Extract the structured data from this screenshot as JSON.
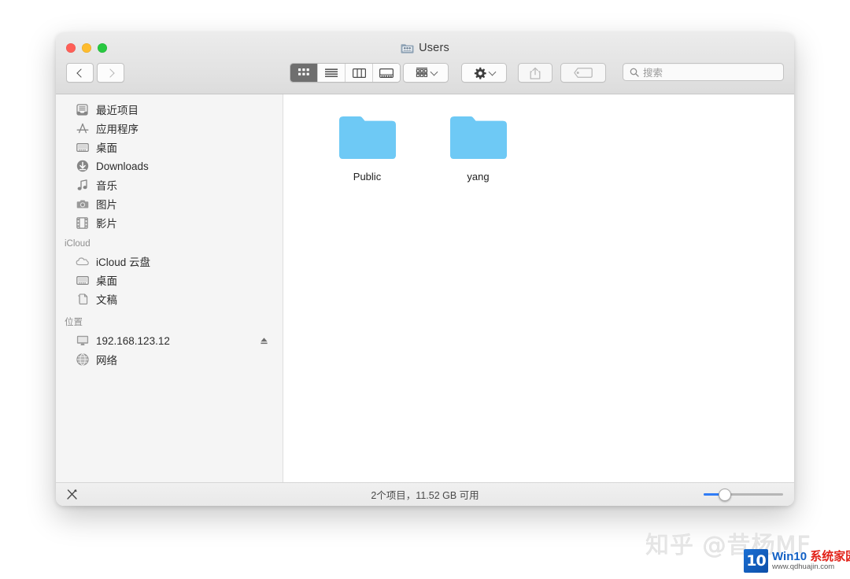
{
  "window": {
    "title": "Users",
    "title_icon": "users-folder-icon",
    "traffic_lights": [
      {
        "name": "close",
        "color": "#ff5f57"
      },
      {
        "name": "minimize",
        "color": "#febc2e"
      },
      {
        "name": "zoom",
        "color": "#28c840"
      }
    ]
  },
  "toolbar": {
    "back_label": "back-chevron",
    "forward_label": "forward-chevron",
    "view_modes": [
      {
        "name": "icon-view",
        "active": true
      },
      {
        "name": "list-view",
        "active": false
      },
      {
        "name": "column-view",
        "active": false
      },
      {
        "name": "gallery-view",
        "active": false
      }
    ],
    "arrange_button": "arrange-icon",
    "action_button": "gear-icon",
    "share_button": "share-icon",
    "tag_button": "tag-icon"
  },
  "search": {
    "placeholder": "搜索",
    "value": ""
  },
  "sidebar": {
    "sections": [
      {
        "title": "",
        "items": [
          {
            "label": "最近项目",
            "icon": "recents-icon"
          },
          {
            "label": "应用程序",
            "icon": "applications-icon"
          },
          {
            "label": "桌面",
            "icon": "desktop-icon"
          },
          {
            "label": "Downloads",
            "icon": "downloads-icon"
          },
          {
            "label": "音乐",
            "icon": "music-icon"
          },
          {
            "label": "图片",
            "icon": "pictures-icon"
          },
          {
            "label": "影片",
            "icon": "movies-icon"
          }
        ]
      },
      {
        "title": "iCloud",
        "items": [
          {
            "label": "iCloud 云盘",
            "icon": "icloud-icon"
          },
          {
            "label": "桌面",
            "icon": "desktop-icon"
          },
          {
            "label": "文稿",
            "icon": "documents-icon"
          }
        ]
      },
      {
        "title": "位置",
        "items": [
          {
            "label": "192.168.123.12",
            "icon": "server-icon",
            "eject": true
          },
          {
            "label": "网络",
            "icon": "network-icon"
          }
        ]
      }
    ]
  },
  "content": {
    "files": [
      {
        "name": "Public",
        "icon": "folder-icon"
      },
      {
        "name": "yang",
        "icon": "folder-icon"
      }
    ]
  },
  "statusbar": {
    "left_icon": "markup-tools-icon",
    "text": "2个项目，11.52 GB 可用",
    "zoom_slider_percent": "25"
  },
  "watermarks": {
    "zhihu": "知乎 @昔杨MF",
    "win10_badge": "10",
    "win10_main_left": "Win10 ",
    "win10_main_right": "系统家园",
    "win10_url": "www.qdhuajin.com"
  },
  "colors": {
    "accent": "#2f7cf6",
    "folder": "#6ec9f5",
    "sidebar_bg": "#f5f5f5"
  }
}
